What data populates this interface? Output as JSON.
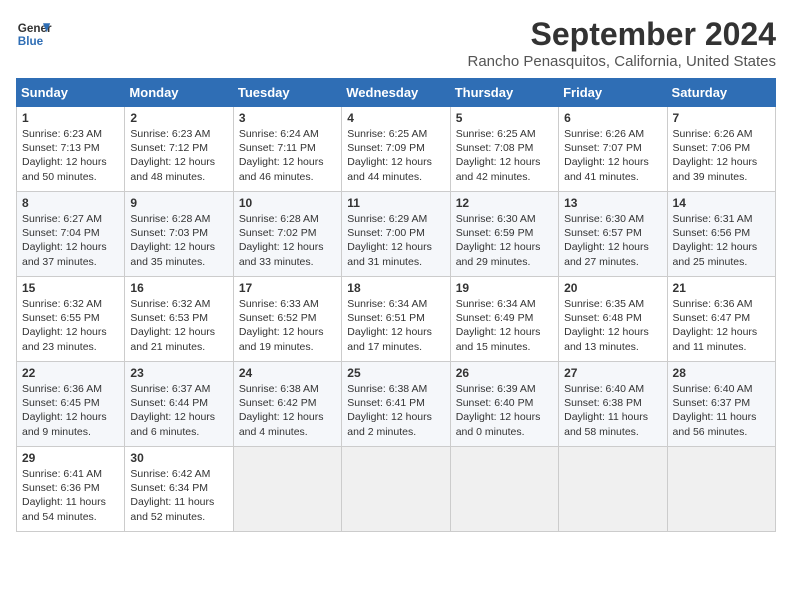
{
  "header": {
    "logo_line1": "General",
    "logo_line2": "Blue",
    "title": "September 2024",
    "subtitle": "Rancho Penasquitos, California, United States"
  },
  "calendar": {
    "columns": [
      "Sunday",
      "Monday",
      "Tuesday",
      "Wednesday",
      "Thursday",
      "Friday",
      "Saturday"
    ],
    "weeks": [
      [
        {
          "day": "1",
          "info": "Sunrise: 6:23 AM\nSunset: 7:13 PM\nDaylight: 12 hours\nand 50 minutes."
        },
        {
          "day": "2",
          "info": "Sunrise: 6:23 AM\nSunset: 7:12 PM\nDaylight: 12 hours\nand 48 minutes."
        },
        {
          "day": "3",
          "info": "Sunrise: 6:24 AM\nSunset: 7:11 PM\nDaylight: 12 hours\nand 46 minutes."
        },
        {
          "day": "4",
          "info": "Sunrise: 6:25 AM\nSunset: 7:09 PM\nDaylight: 12 hours\nand 44 minutes."
        },
        {
          "day": "5",
          "info": "Sunrise: 6:25 AM\nSunset: 7:08 PM\nDaylight: 12 hours\nand 42 minutes."
        },
        {
          "day": "6",
          "info": "Sunrise: 6:26 AM\nSunset: 7:07 PM\nDaylight: 12 hours\nand 41 minutes."
        },
        {
          "day": "7",
          "info": "Sunrise: 6:26 AM\nSunset: 7:06 PM\nDaylight: 12 hours\nand 39 minutes."
        }
      ],
      [
        {
          "day": "8",
          "info": "Sunrise: 6:27 AM\nSunset: 7:04 PM\nDaylight: 12 hours\nand 37 minutes."
        },
        {
          "day": "9",
          "info": "Sunrise: 6:28 AM\nSunset: 7:03 PM\nDaylight: 12 hours\nand 35 minutes."
        },
        {
          "day": "10",
          "info": "Sunrise: 6:28 AM\nSunset: 7:02 PM\nDaylight: 12 hours\nand 33 minutes."
        },
        {
          "day": "11",
          "info": "Sunrise: 6:29 AM\nSunset: 7:00 PM\nDaylight: 12 hours\nand 31 minutes."
        },
        {
          "day": "12",
          "info": "Sunrise: 6:30 AM\nSunset: 6:59 PM\nDaylight: 12 hours\nand 29 minutes."
        },
        {
          "day": "13",
          "info": "Sunrise: 6:30 AM\nSunset: 6:57 PM\nDaylight: 12 hours\nand 27 minutes."
        },
        {
          "day": "14",
          "info": "Sunrise: 6:31 AM\nSunset: 6:56 PM\nDaylight: 12 hours\nand 25 minutes."
        }
      ],
      [
        {
          "day": "15",
          "info": "Sunrise: 6:32 AM\nSunset: 6:55 PM\nDaylight: 12 hours\nand 23 minutes."
        },
        {
          "day": "16",
          "info": "Sunrise: 6:32 AM\nSunset: 6:53 PM\nDaylight: 12 hours\nand 21 minutes."
        },
        {
          "day": "17",
          "info": "Sunrise: 6:33 AM\nSunset: 6:52 PM\nDaylight: 12 hours\nand 19 minutes."
        },
        {
          "day": "18",
          "info": "Sunrise: 6:34 AM\nSunset: 6:51 PM\nDaylight: 12 hours\nand 17 minutes."
        },
        {
          "day": "19",
          "info": "Sunrise: 6:34 AM\nSunset: 6:49 PM\nDaylight: 12 hours\nand 15 minutes."
        },
        {
          "day": "20",
          "info": "Sunrise: 6:35 AM\nSunset: 6:48 PM\nDaylight: 12 hours\nand 13 minutes."
        },
        {
          "day": "21",
          "info": "Sunrise: 6:36 AM\nSunset: 6:47 PM\nDaylight: 12 hours\nand 11 minutes."
        }
      ],
      [
        {
          "day": "22",
          "info": "Sunrise: 6:36 AM\nSunset: 6:45 PM\nDaylight: 12 hours\nand 9 minutes."
        },
        {
          "day": "23",
          "info": "Sunrise: 6:37 AM\nSunset: 6:44 PM\nDaylight: 12 hours\nand 6 minutes."
        },
        {
          "day": "24",
          "info": "Sunrise: 6:38 AM\nSunset: 6:42 PM\nDaylight: 12 hours\nand 4 minutes."
        },
        {
          "day": "25",
          "info": "Sunrise: 6:38 AM\nSunset: 6:41 PM\nDaylight: 12 hours\nand 2 minutes."
        },
        {
          "day": "26",
          "info": "Sunrise: 6:39 AM\nSunset: 6:40 PM\nDaylight: 12 hours\nand 0 minutes."
        },
        {
          "day": "27",
          "info": "Sunrise: 6:40 AM\nSunset: 6:38 PM\nDaylight: 11 hours\nand 58 minutes."
        },
        {
          "day": "28",
          "info": "Sunrise: 6:40 AM\nSunset: 6:37 PM\nDaylight: 11 hours\nand 56 minutes."
        }
      ],
      [
        {
          "day": "29",
          "info": "Sunrise: 6:41 AM\nSunset: 6:36 PM\nDaylight: 11 hours\nand 54 minutes."
        },
        {
          "day": "30",
          "info": "Sunrise: 6:42 AM\nSunset: 6:34 PM\nDaylight: 11 hours\nand 52 minutes."
        },
        {
          "day": "",
          "info": ""
        },
        {
          "day": "",
          "info": ""
        },
        {
          "day": "",
          "info": ""
        },
        {
          "day": "",
          "info": ""
        },
        {
          "day": "",
          "info": ""
        }
      ]
    ]
  }
}
